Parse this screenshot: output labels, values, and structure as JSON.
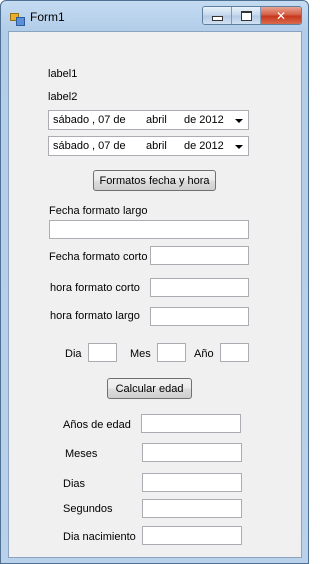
{
  "window": {
    "title": "Form1"
  },
  "labels": {
    "label1": "label1",
    "label2": "label2",
    "fecha_largo": "Fecha formato largo",
    "fecha_corto": "Fecha formato corto",
    "hora_corto": "hora formato corto",
    "hora_largo": "hora formato largo",
    "dia": "Dia",
    "mes": "Mes",
    "anio": "Año",
    "anios_edad": "Años de edad",
    "meses": "Meses",
    "dias": "Dias",
    "segundos": "Segundos",
    "dia_nacimiento": "Dia nacimiento"
  },
  "date_pickers": [
    {
      "weekday": "sábado",
      "day": ", 07 de",
      "month": "abril",
      "year": "de 2012"
    },
    {
      "weekday": "sábado",
      "day": ", 07 de",
      "month": "abril",
      "year": "de 2012"
    }
  ],
  "buttons": {
    "formatos": "Formatos fecha y hora",
    "calcular": "Calcular edad"
  },
  "inputs": {
    "fecha_largo": "",
    "fecha_corto": "",
    "hora_corto": "",
    "hora_largo": "",
    "dia": "",
    "mes": "",
    "anio": "",
    "anios_edad": "",
    "meses": "",
    "dias": "",
    "segundos": "",
    "dia_nacimiento": ""
  }
}
